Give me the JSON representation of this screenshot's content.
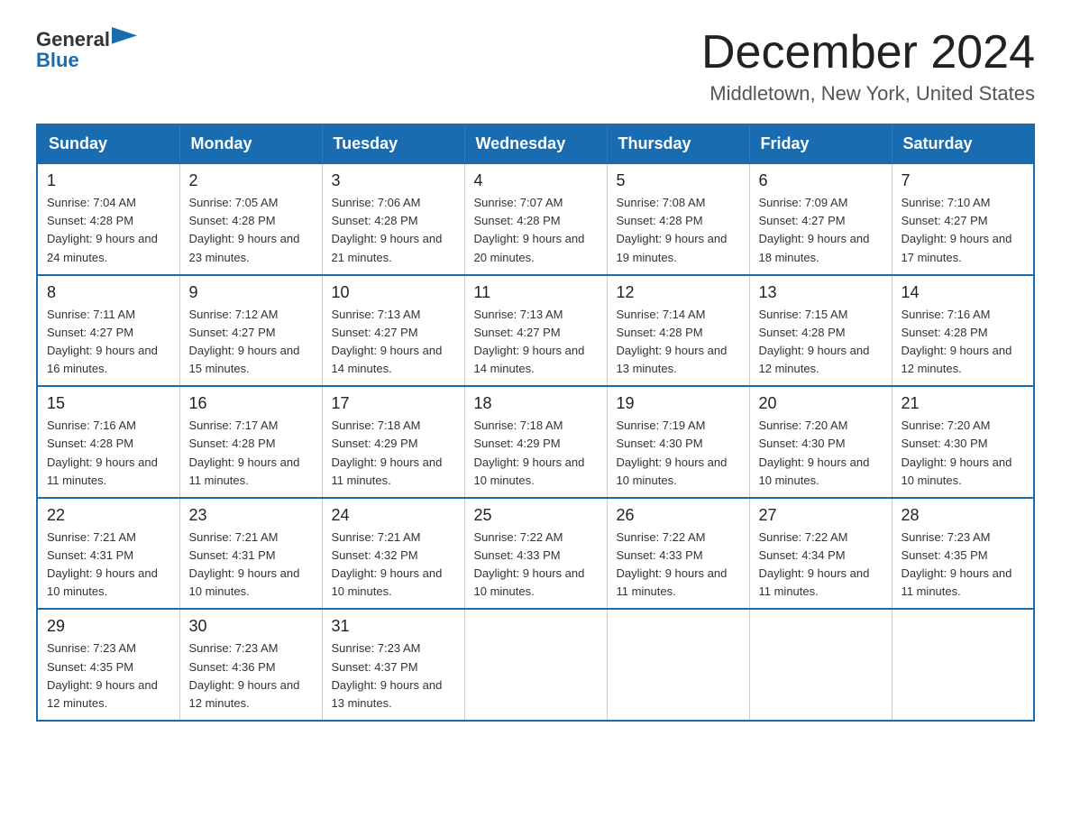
{
  "header": {
    "logo": {
      "general": "General",
      "blue": "Blue"
    },
    "title": "December 2024",
    "location": "Middletown, New York, United States"
  },
  "calendar": {
    "days": [
      "Sunday",
      "Monday",
      "Tuesday",
      "Wednesday",
      "Thursday",
      "Friday",
      "Saturday"
    ],
    "weeks": [
      [
        {
          "day": "1",
          "sunrise": "7:04 AM",
          "sunset": "4:28 PM",
          "daylight": "9 hours and 24 minutes."
        },
        {
          "day": "2",
          "sunrise": "7:05 AM",
          "sunset": "4:28 PM",
          "daylight": "9 hours and 23 minutes."
        },
        {
          "day": "3",
          "sunrise": "7:06 AM",
          "sunset": "4:28 PM",
          "daylight": "9 hours and 21 minutes."
        },
        {
          "day": "4",
          "sunrise": "7:07 AM",
          "sunset": "4:28 PM",
          "daylight": "9 hours and 20 minutes."
        },
        {
          "day": "5",
          "sunrise": "7:08 AM",
          "sunset": "4:28 PM",
          "daylight": "9 hours and 19 minutes."
        },
        {
          "day": "6",
          "sunrise": "7:09 AM",
          "sunset": "4:27 PM",
          "daylight": "9 hours and 18 minutes."
        },
        {
          "day": "7",
          "sunrise": "7:10 AM",
          "sunset": "4:27 PM",
          "daylight": "9 hours and 17 minutes."
        }
      ],
      [
        {
          "day": "8",
          "sunrise": "7:11 AM",
          "sunset": "4:27 PM",
          "daylight": "9 hours and 16 minutes."
        },
        {
          "day": "9",
          "sunrise": "7:12 AM",
          "sunset": "4:27 PM",
          "daylight": "9 hours and 15 minutes."
        },
        {
          "day": "10",
          "sunrise": "7:13 AM",
          "sunset": "4:27 PM",
          "daylight": "9 hours and 14 minutes."
        },
        {
          "day": "11",
          "sunrise": "7:13 AM",
          "sunset": "4:27 PM",
          "daylight": "9 hours and 14 minutes."
        },
        {
          "day": "12",
          "sunrise": "7:14 AM",
          "sunset": "4:28 PM",
          "daylight": "9 hours and 13 minutes."
        },
        {
          "day": "13",
          "sunrise": "7:15 AM",
          "sunset": "4:28 PM",
          "daylight": "9 hours and 12 minutes."
        },
        {
          "day": "14",
          "sunrise": "7:16 AM",
          "sunset": "4:28 PM",
          "daylight": "9 hours and 12 minutes."
        }
      ],
      [
        {
          "day": "15",
          "sunrise": "7:16 AM",
          "sunset": "4:28 PM",
          "daylight": "9 hours and 11 minutes."
        },
        {
          "day": "16",
          "sunrise": "7:17 AM",
          "sunset": "4:28 PM",
          "daylight": "9 hours and 11 minutes."
        },
        {
          "day": "17",
          "sunrise": "7:18 AM",
          "sunset": "4:29 PM",
          "daylight": "9 hours and 11 minutes."
        },
        {
          "day": "18",
          "sunrise": "7:18 AM",
          "sunset": "4:29 PM",
          "daylight": "9 hours and 10 minutes."
        },
        {
          "day": "19",
          "sunrise": "7:19 AM",
          "sunset": "4:30 PM",
          "daylight": "9 hours and 10 minutes."
        },
        {
          "day": "20",
          "sunrise": "7:20 AM",
          "sunset": "4:30 PM",
          "daylight": "9 hours and 10 minutes."
        },
        {
          "day": "21",
          "sunrise": "7:20 AM",
          "sunset": "4:30 PM",
          "daylight": "9 hours and 10 minutes."
        }
      ],
      [
        {
          "day": "22",
          "sunrise": "7:21 AM",
          "sunset": "4:31 PM",
          "daylight": "9 hours and 10 minutes."
        },
        {
          "day": "23",
          "sunrise": "7:21 AM",
          "sunset": "4:31 PM",
          "daylight": "9 hours and 10 minutes."
        },
        {
          "day": "24",
          "sunrise": "7:21 AM",
          "sunset": "4:32 PM",
          "daylight": "9 hours and 10 minutes."
        },
        {
          "day": "25",
          "sunrise": "7:22 AM",
          "sunset": "4:33 PM",
          "daylight": "9 hours and 10 minutes."
        },
        {
          "day": "26",
          "sunrise": "7:22 AM",
          "sunset": "4:33 PM",
          "daylight": "9 hours and 11 minutes."
        },
        {
          "day": "27",
          "sunrise": "7:22 AM",
          "sunset": "4:34 PM",
          "daylight": "9 hours and 11 minutes."
        },
        {
          "day": "28",
          "sunrise": "7:23 AM",
          "sunset": "4:35 PM",
          "daylight": "9 hours and 11 minutes."
        }
      ],
      [
        {
          "day": "29",
          "sunrise": "7:23 AM",
          "sunset": "4:35 PM",
          "daylight": "9 hours and 12 minutes."
        },
        {
          "day": "30",
          "sunrise": "7:23 AM",
          "sunset": "4:36 PM",
          "daylight": "9 hours and 12 minutes."
        },
        {
          "day": "31",
          "sunrise": "7:23 AM",
          "sunset": "4:37 PM",
          "daylight": "9 hours and 13 minutes."
        },
        null,
        null,
        null,
        null
      ]
    ]
  }
}
